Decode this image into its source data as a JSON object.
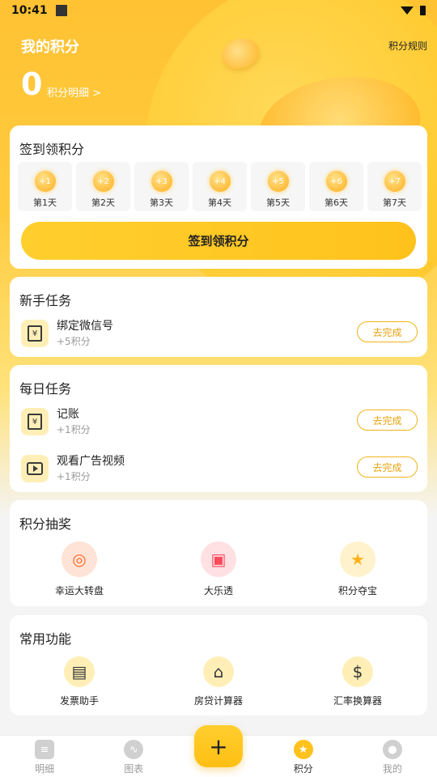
{
  "status": {
    "time": "10:41"
  },
  "header": {
    "title": "我的积分",
    "rules": "积分规则",
    "points": "0",
    "detail": "积分明细 >"
  },
  "checkin": {
    "title": "签到领积分",
    "days": [
      {
        "reward": "+1",
        "label": "第1天"
      },
      {
        "reward": "+2",
        "label": "第2天"
      },
      {
        "reward": "+3",
        "label": "第3天"
      },
      {
        "reward": "+4",
        "label": "第4天"
      },
      {
        "reward": "+5",
        "label": "第5天"
      },
      {
        "reward": "+6",
        "label": "第6天"
      },
      {
        "reward": "+7",
        "label": "第7天"
      }
    ],
    "button": "签到领积分"
  },
  "newbie": {
    "title": "新手任务",
    "tasks": [
      {
        "name": "绑定微信号",
        "points": "+5积分",
        "action": "去完成",
        "icon": "ledger-icon"
      }
    ]
  },
  "daily": {
    "title": "每日任务",
    "tasks": [
      {
        "name": "记账",
        "points": "+1积分",
        "action": "去完成",
        "icon": "ledger-icon"
      },
      {
        "name": "观看广告视频",
        "points": "+1积分",
        "action": "去完成",
        "icon": "video-icon"
      }
    ]
  },
  "lottery": {
    "title": "积分抽奖",
    "items": [
      {
        "label": "幸运大转盘",
        "icon": "wheel-icon",
        "glyph": "◎",
        "color": "#ff7a3d"
      },
      {
        "label": "大乐透",
        "icon": "treasure-chest-icon",
        "glyph": "▣",
        "color": "#ff5a6a"
      },
      {
        "label": "积分夺宝",
        "icon": "star-icon",
        "glyph": "★",
        "color": "#ffb820"
      }
    ]
  },
  "features": {
    "title": "常用功能",
    "items": [
      {
        "label": "发票助手",
        "icon": "invoice-icon",
        "glyph": "▤"
      },
      {
        "label": "房贷计算器",
        "icon": "house-percent-icon",
        "glyph": "⌂"
      },
      {
        "label": "汇率换算器",
        "icon": "currency-exchange-icon",
        "glyph": "$"
      }
    ]
  },
  "tabs": [
    {
      "label": "明细",
      "icon": "detail-icon",
      "glyph": "≡",
      "active": false
    },
    {
      "label": "图表",
      "icon": "chart-icon",
      "glyph": "∿",
      "active": false
    },
    {
      "label": "积分",
      "icon": "points-star-icon",
      "glyph": "★",
      "active": true
    },
    {
      "label": "我的",
      "icon": "profile-icon",
      "glyph": "●",
      "active": false
    }
  ],
  "fab": {
    "label": "+"
  }
}
